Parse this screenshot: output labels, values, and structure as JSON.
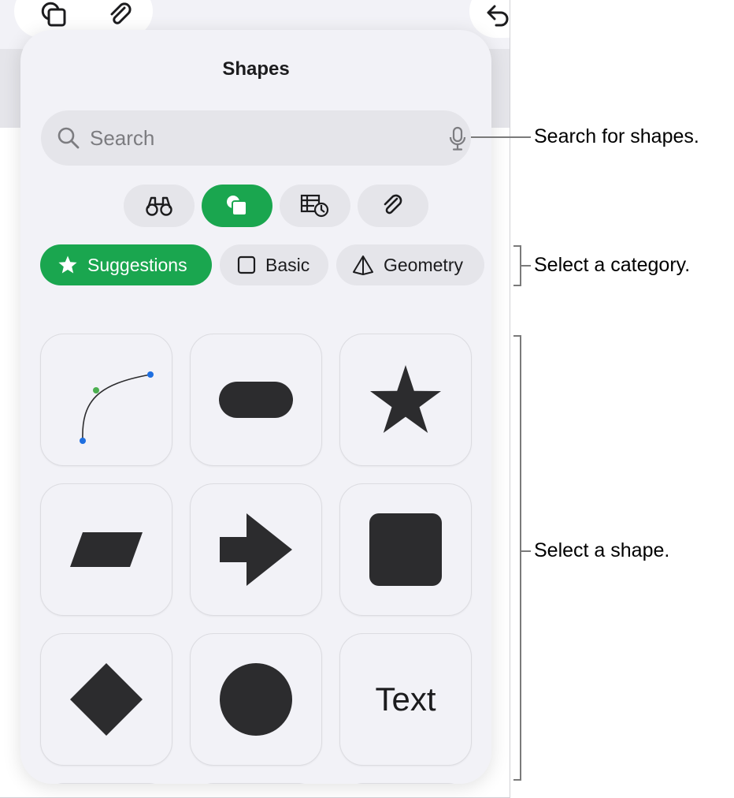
{
  "popover": {
    "title": "Shapes",
    "search": {
      "placeholder": "Search"
    },
    "tabs": [
      {
        "icon": "binoculars-icon",
        "active": false
      },
      {
        "icon": "shapes-icon",
        "active": true
      },
      {
        "icon": "table-chart-icon",
        "active": false
      },
      {
        "icon": "paperclip-icon",
        "active": false
      }
    ],
    "categories": [
      {
        "label": "Suggestions",
        "icon": "star-icon",
        "active": true
      },
      {
        "label": "Basic",
        "icon": "square-outline-icon",
        "active": false
      },
      {
        "label": "Geometry",
        "icon": "pyramid-icon",
        "active": false
      }
    ],
    "shapes": [
      {
        "name": "curve-shape"
      },
      {
        "name": "rounded-rectangle-shape"
      },
      {
        "name": "star-shape"
      },
      {
        "name": "parallelogram-shape"
      },
      {
        "name": "arrow-shape"
      },
      {
        "name": "rounded-square-shape"
      },
      {
        "name": "diamond-shape"
      },
      {
        "name": "circle-shape"
      },
      {
        "name": "text-shape",
        "label": "Text"
      }
    ]
  },
  "callouts": {
    "search": "Search for shapes.",
    "category": "Select a category.",
    "shape": "Select a shape."
  },
  "colors": {
    "accent": "#1aa64f",
    "shape_fill": "#2c2c2e",
    "curve_end_point": "#1f6fe0",
    "curve_mid_point": "#4caf50"
  }
}
